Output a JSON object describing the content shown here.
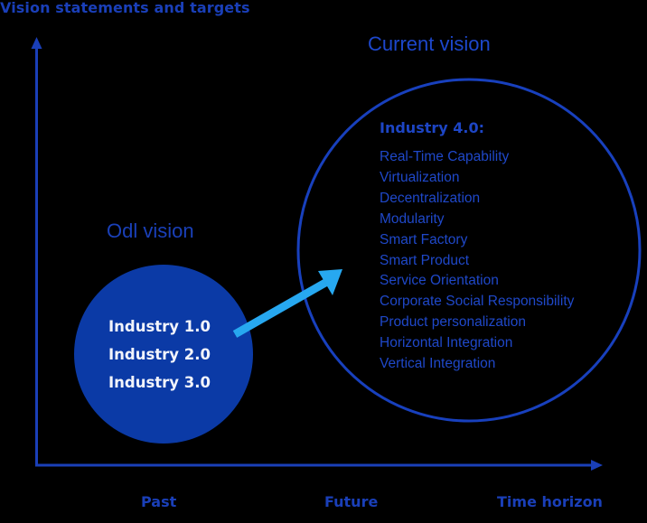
{
  "diagram": {
    "y_axis_label": "Vision statements and targets",
    "x_axis_labels": [
      "Past",
      "Future",
      "Time horizon"
    ],
    "old_vision": {
      "title": "Odl vision",
      "items": [
        "Industry 1.0",
        "Industry 2.0",
        "Industry 3.0"
      ]
    },
    "current_vision": {
      "title": "Current vision",
      "heading": "Industry 4.0:",
      "items": [
        "Real-Time Capability",
        "Virtualization",
        "Decentralization",
        "Modularity",
        "Smart Factory",
        "Smart Product",
        "Service Orientation",
        "Corporate Social Responsibility",
        "Product personalization",
        "Horizontal Integration",
        "Vertical Integration"
      ]
    },
    "colors": {
      "background": "#000000",
      "axis": "#1a3fb8",
      "old_circle_fill": "#0b3aa6",
      "current_circle_stroke": "#1840bd",
      "arrow": "#27a8f0",
      "text_blue": "#1d45c4",
      "text_white": "#f2f4fb"
    }
  }
}
